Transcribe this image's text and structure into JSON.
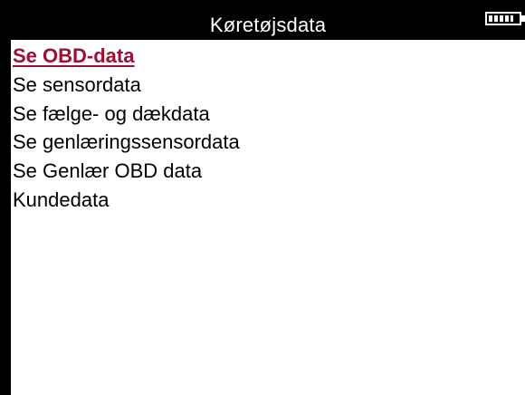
{
  "header": {
    "title": "Køretøjsdata",
    "battery_icon": "battery-icon",
    "battery_level": 0.85
  },
  "menu": {
    "items": [
      {
        "label": "Se OBD-data",
        "selected": true
      },
      {
        "label": "Se sensordata",
        "selected": false
      },
      {
        "label": "Se fælge- og dækdata",
        "selected": false
      },
      {
        "label": "Se genlæringssensordata",
        "selected": false
      },
      {
        "label": "Se Genlær OBD data",
        "selected": false
      },
      {
        "label": "Kundedata",
        "selected": false
      }
    ]
  },
  "colors": {
    "selected_text": "#9b1034",
    "header_background": "#000000",
    "content_background": "#ffffff"
  }
}
